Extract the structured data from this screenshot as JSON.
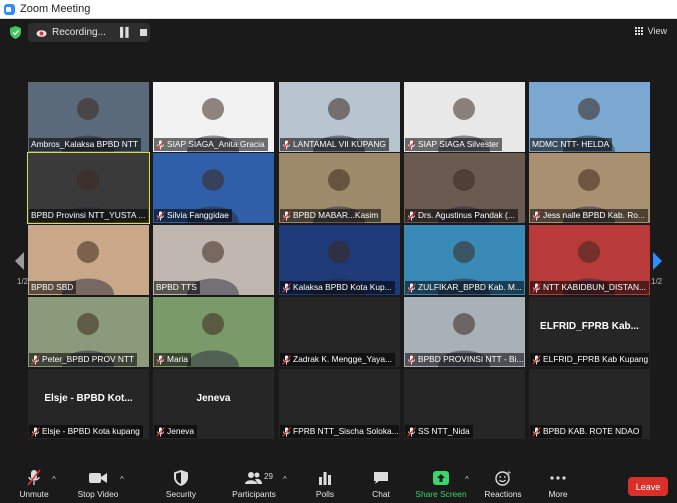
{
  "window": {
    "title": "Zoom Meeting"
  },
  "top": {
    "recording_label": "Recording...",
    "view_label": "View"
  },
  "pager": {
    "left": "1/2",
    "right": "1/2"
  },
  "tiles": [
    {
      "label": "Ambros_Kalaksa BPBD NTT",
      "muted": false,
      "bg": "#5a6a7a"
    },
    {
      "label": "SIAP SIAGA_Anita Gracia",
      "muted": true,
      "bg": "#f2f2f2"
    },
    {
      "label": "LANTAMAL VII KUPANG",
      "muted": true,
      "bg": "#b8c4d0"
    },
    {
      "label": "SIAP SIAGA Silvester",
      "muted": true,
      "bg": "#e8e8e8"
    },
    {
      "label": "MDMC NTT- HELDA",
      "muted": false,
      "bg": "#7aa8d0"
    },
    {
      "label": "BPBD Provinsi NTT_YUSTA ...",
      "muted": false,
      "bg": "#3a3a3a"
    },
    {
      "label": "Silvia Fanggidae",
      "muted": true,
      "bg": "#2f5fa8"
    },
    {
      "label": "BPBD MABAR...Kasim",
      "muted": true,
      "bg": "#9c8a6a"
    },
    {
      "label": "Drs. Agustinus Pandak (...",
      "muted": true,
      "bg": "#6a5a50"
    },
    {
      "label": "Jess nalle BPBD Kab. Ro...",
      "muted": true,
      "bg": "#a89070"
    },
    {
      "label": "BPBD SBD",
      "muted": false,
      "bg": "#c8a888"
    },
    {
      "label": "BPBD TTS",
      "muted": false,
      "bg": "#c0b8b0"
    },
    {
      "label": "Kalaksa BPBD Kota Kup...",
      "muted": true,
      "bg": "#1e3a78"
    },
    {
      "label": "ZULFIKAR_BPBD Kab. M...",
      "muted": true,
      "bg": "#3a8ab8"
    },
    {
      "label": "NTT KABIDBUN_DISTAN...",
      "muted": true,
      "bg": "#b83a3a"
    },
    {
      "label": "Peter_BPBD PROV NTT",
      "muted": true,
      "bg": "#8a9a7a"
    },
    {
      "label": "Maria",
      "muted": true,
      "bg": "#7a9a6a"
    },
    {
      "label": "Zadrak K. Mengge_Yaya...",
      "muted": true,
      "bg": "#262626"
    },
    {
      "label": "BPBD PROVINSI NTT - Bi...",
      "muted": true,
      "bg": "#a8b0b8"
    },
    {
      "label": "ELFRID_FPRB Kab Kupang",
      "muted": true,
      "bg": "#262626"
    },
    {
      "label": "Elsje - BPBD Kota kupang",
      "muted": true,
      "bg": "#262626"
    },
    {
      "label": "Jeneva",
      "muted": true,
      "bg": "#262626"
    },
    {
      "label": "FPRB NTT_Sischa Soloka...",
      "muted": true,
      "bg": "#262626"
    },
    {
      "label": "SS NTT_Nida",
      "muted": true,
      "bg": "#262626"
    },
    {
      "label": "BPBD KAB. ROTE NDAO",
      "muted": true,
      "bg": "#262626"
    }
  ],
  "name_cards": {
    "t19": "ELFRID_FPRB Kab...",
    "t20": "Elsje - BPBD Kot...",
    "t21": "Jeneva"
  },
  "toolbar": {
    "unmute": "Unmute",
    "stop_video": "Stop Video",
    "security": "Security",
    "participants": "Participants",
    "participants_count": "29",
    "polls": "Polls",
    "chat": "Chat",
    "share_screen": "Share Screen",
    "reactions": "Reactions",
    "more": "More",
    "leave": "Leave"
  },
  "colors": {
    "share": "#38d66b",
    "leave": "#d9302a",
    "active_speaker": "#d9e234",
    "nav_arrow": "#2d8cff"
  }
}
